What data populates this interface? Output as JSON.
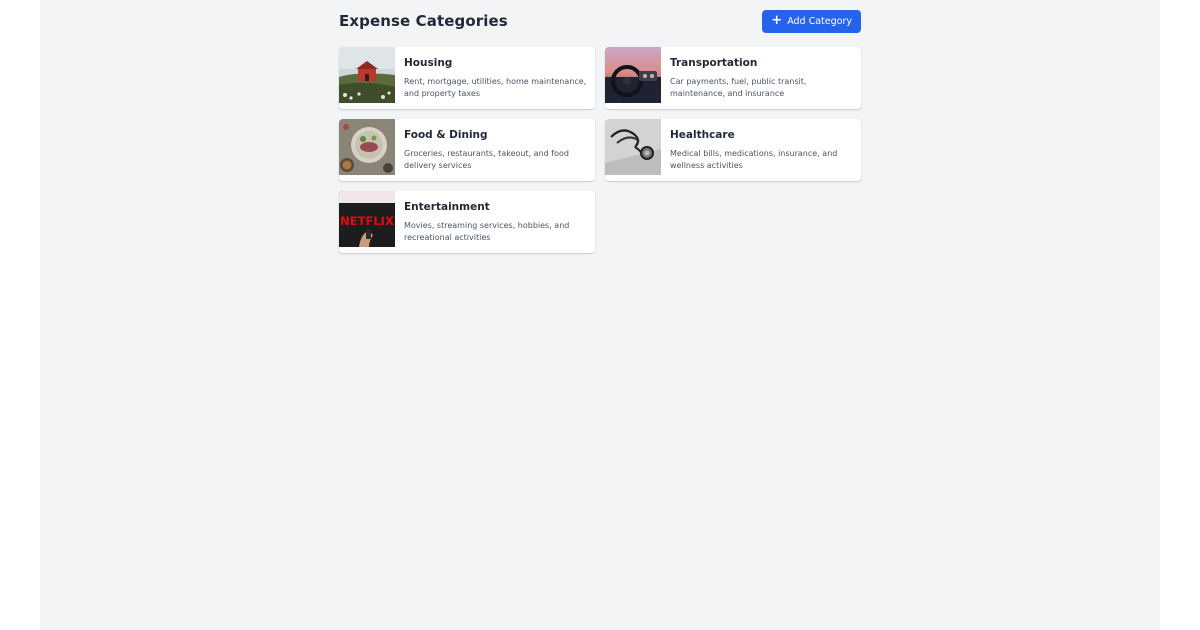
{
  "page": {
    "title": "Expense Categories",
    "add_button_label": "Add Category",
    "add_button_icon": "plus-icon",
    "accent_color": "#2563eb"
  },
  "categories": [
    {
      "title": "Housing",
      "description": "Rent, mortgage, utilities, home maintenance, and property taxes",
      "image": "red-house-photo"
    },
    {
      "title": "Transportation",
      "description": "Car payments, fuel, public transit, maintenance, and insurance",
      "image": "car-dashboard-photo"
    },
    {
      "title": "Food & Dining",
      "description": "Groceries, restaurants, takeout, and food delivery services",
      "image": "food-plates-photo"
    },
    {
      "title": "Healthcare",
      "description": "Medical bills, medications, insurance, and wellness activities",
      "image": "stethoscope-photo"
    },
    {
      "title": "Entertainment",
      "description": "Movies, streaming services, hobbies, and recreational activities",
      "image": "netflix-tv-photo",
      "image_text": "NETFLIX"
    }
  ]
}
